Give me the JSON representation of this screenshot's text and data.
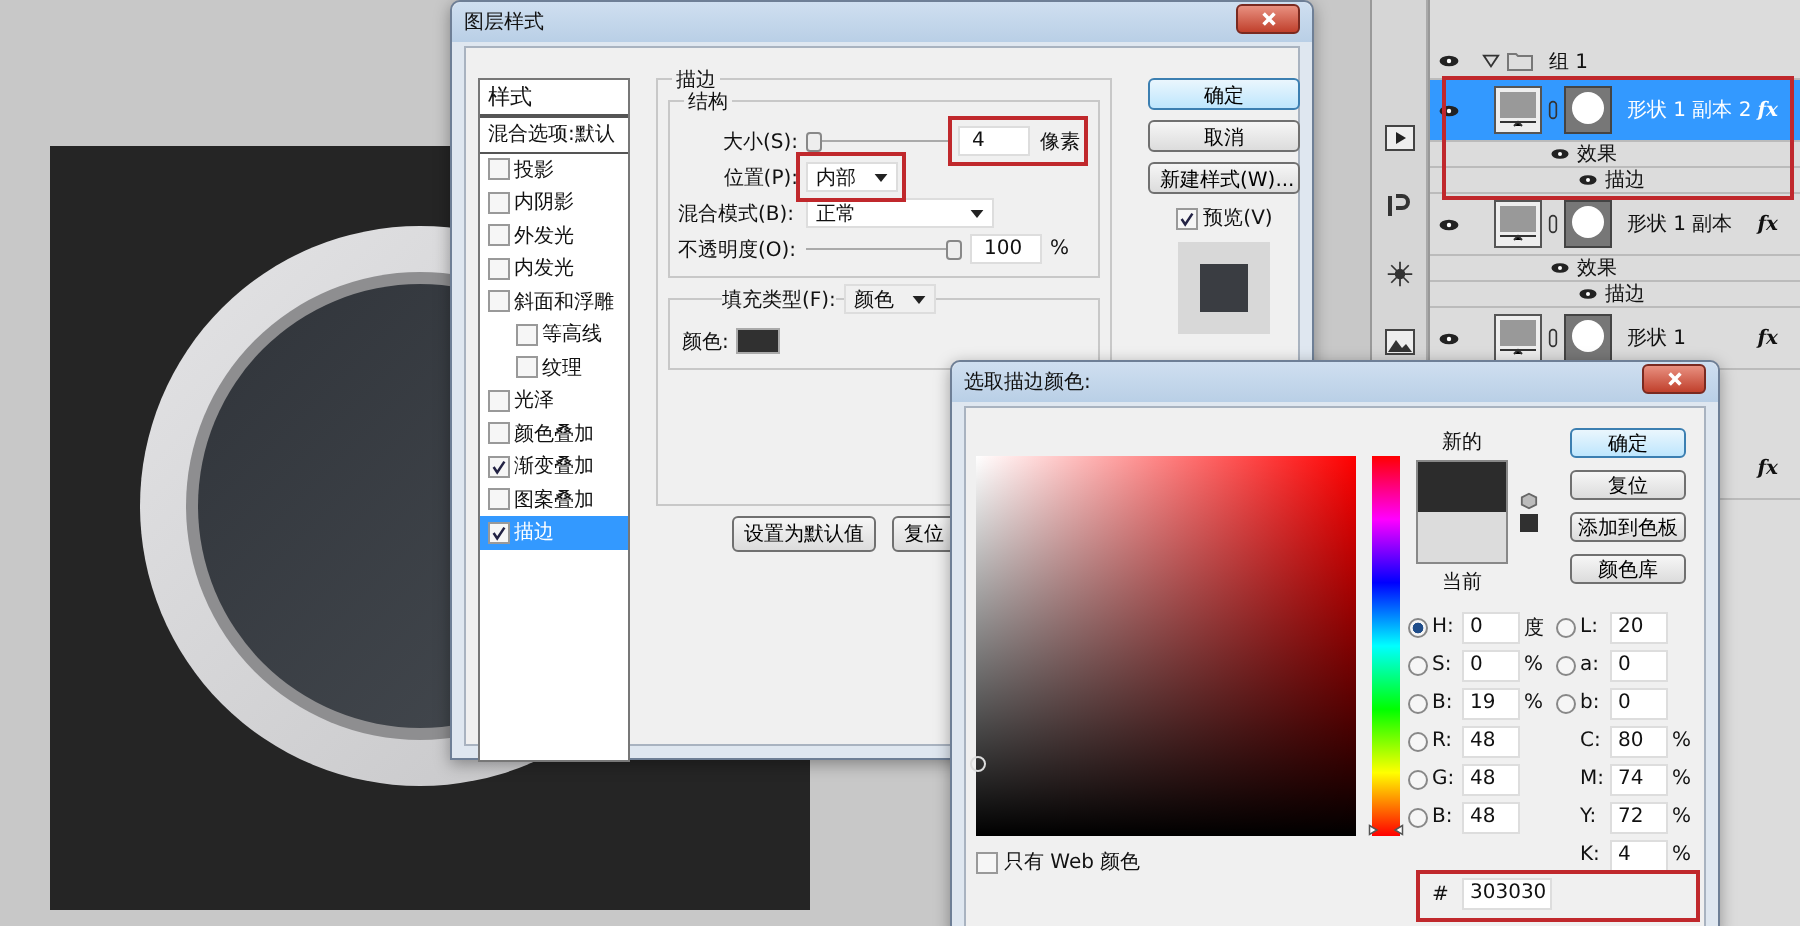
{
  "layer_style_dialog": {
    "title": "图层样式",
    "styles": [
      {
        "label": "样式",
        "kind": "header",
        "selected": false
      },
      {
        "label": "混合选项:默认",
        "kind": "plain",
        "selected": false
      },
      {
        "label": "投影",
        "kind": "check",
        "checked": false,
        "selected": false
      },
      {
        "label": "内阴影",
        "kind": "check",
        "checked": false,
        "selected": false
      },
      {
        "label": "外发光",
        "kind": "check",
        "checked": false,
        "selected": false
      },
      {
        "label": "内发光",
        "kind": "check",
        "checked": false,
        "selected": false
      },
      {
        "label": "斜面和浮雕",
        "kind": "check",
        "checked": false,
        "selected": false,
        "children": [
          {
            "label": "等高线",
            "kind": "check",
            "checked": false,
            "selected": false
          },
          {
            "label": "纹理",
            "kind": "check",
            "checked": false,
            "selected": false
          }
        ]
      },
      {
        "label": "光泽",
        "kind": "check",
        "checked": false,
        "selected": false
      },
      {
        "label": "颜色叠加",
        "kind": "check",
        "checked": false,
        "selected": false
      },
      {
        "label": "渐变叠加",
        "kind": "check",
        "checked": true,
        "selected": false
      },
      {
        "label": "图案叠加",
        "kind": "check",
        "checked": false,
        "selected": false
      },
      {
        "label": "描边",
        "kind": "check",
        "checked": true,
        "selected": true
      }
    ],
    "stroke": {
      "title": "描边",
      "structure_title": "结构",
      "size": {
        "label": "大小(S):",
        "level": 0.0,
        "value": "4",
        "unit": "像素"
      },
      "position": {
        "label": "位置(P):",
        "value": "内部"
      },
      "blend_mode": {
        "label": "混合模式(B):",
        "value": "正常"
      },
      "opacity": {
        "label": "不透明度(O):",
        "level": 1.0,
        "value": "100",
        "unit": "%"
      },
      "fill_type": {
        "label": "填充类型(F):",
        "value": "颜色"
      },
      "color": {
        "label": "颜色:"
      },
      "buttons": [
        "设置为默认值",
        "复位"
      ]
    },
    "side_buttons": [
      {
        "label": "确定",
        "default": true
      },
      {
        "label": "取消",
        "default": false
      },
      {
        "label": "新建样式(W)...",
        "default": false
      }
    ],
    "preview": {
      "label": "预览(V)",
      "checked": true
    }
  },
  "layers_panel": {
    "group": {
      "name": "组 1",
      "expanded": true
    },
    "layers": [
      {
        "name": "形状 1 副本 2",
        "fx": "fx",
        "selected": true,
        "effects_label": "效果",
        "effects": [
          "描边"
        ]
      },
      {
        "name": "形状 1 副本",
        "fx": "fx",
        "selected": false,
        "effects_label": "效果",
        "effects": [
          "描边"
        ]
      },
      {
        "name": "形状 1",
        "fx": "fx",
        "selected": false
      }
    ],
    "hidden_row_fx": "fx"
  },
  "color_picker": {
    "title": "选取描边颜色:",
    "new_label": "新的",
    "current_label": "当前",
    "buttons": [
      {
        "label": "确定",
        "default": true
      },
      {
        "label": "复位",
        "default": false
      },
      {
        "label": "添加到色板",
        "default": false
      },
      {
        "label": "颜色库",
        "default": false
      }
    ],
    "fields_left": [
      {
        "label": "H:",
        "value": "0",
        "unit": "度",
        "kind": "radio",
        "selected": true
      },
      {
        "label": "S:",
        "value": "0",
        "unit": "%",
        "kind": "radio",
        "selected": false
      },
      {
        "label": "B:",
        "value": "19",
        "unit": "%",
        "kind": "radio",
        "selected": false
      },
      {
        "label": "R:",
        "value": "48",
        "kind": "radio",
        "selected": false
      },
      {
        "label": "G:",
        "value": "48",
        "kind": "radio",
        "selected": false
      },
      {
        "label": "B:",
        "value": "48",
        "kind": "radio",
        "selected": false
      }
    ],
    "fields_right": [
      {
        "label": "L:",
        "value": "20",
        "kind": "radio",
        "selected": false
      },
      {
        "label": "a:",
        "value": "0",
        "kind": "radio",
        "selected": false
      },
      {
        "label": "b:",
        "value": "0",
        "kind": "radio",
        "selected": false
      },
      {
        "label": "C:",
        "value": "80",
        "unit": "%",
        "kind": "plain"
      },
      {
        "label": "M:",
        "value": "74",
        "unit": "%",
        "kind": "plain"
      },
      {
        "label": "Y:",
        "value": "72",
        "unit": "%",
        "kind": "plain"
      },
      {
        "label": "K:",
        "value": "4",
        "unit": "%",
        "kind": "plain"
      }
    ],
    "hue_slider": {
      "level": 0.0
    },
    "web_only": {
      "label": "只有 Web 颜色",
      "checked": false
    },
    "hex": {
      "label": "#",
      "value": "303030"
    }
  }
}
